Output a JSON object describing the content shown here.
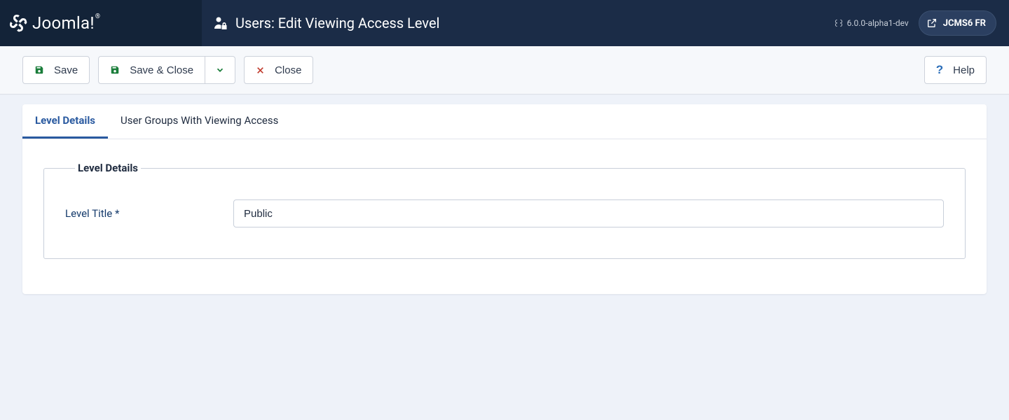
{
  "brand": {
    "name": "Joomla!"
  },
  "header": {
    "page_title": "Users: Edit Viewing Access Level",
    "version": "6.0.0-alpha1-dev",
    "site_pill": "JCMS6 FR"
  },
  "toolbar": {
    "save": "Save",
    "save_close": "Save & Close",
    "close": "Close",
    "help": "Help"
  },
  "tabs": {
    "level_details": "Level Details",
    "user_groups": "User Groups With Viewing Access"
  },
  "form": {
    "fieldset_legend": "Level Details",
    "title_label": "Level Title *",
    "title_value": "Public"
  }
}
